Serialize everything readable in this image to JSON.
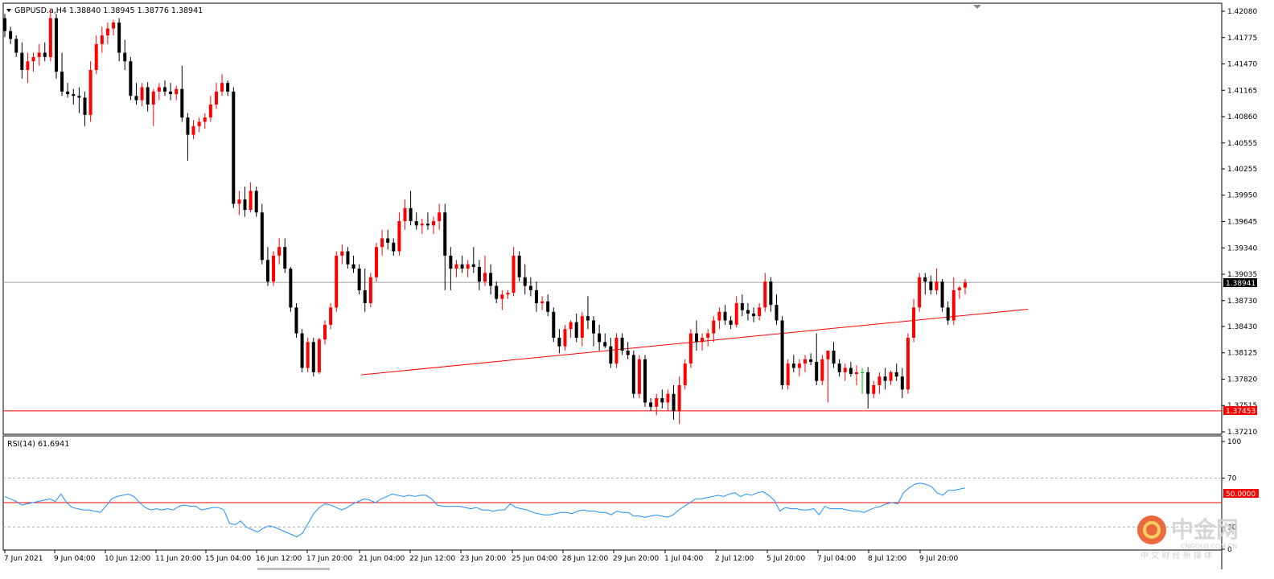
{
  "main_chart": {
    "symbol_header": "GBPUSD.a,H4  1.38840 1.38945 1.38776 1.38941",
    "type": "candlestick",
    "current_price_label": "1.38941",
    "support_label": "1.37453",
    "y_ticks": [
      "1.42080",
      "1.41775",
      "1.41470",
      "1.41165",
      "1.40860",
      "1.40555",
      "1.40255",
      "1.39950",
      "1.39645",
      "1.39340",
      "1.39035",
      "1.38730",
      "1.38430",
      "1.38125",
      "1.37820",
      "1.37515",
      "1.37210"
    ],
    "colors": {
      "bull": "#ff0000",
      "bear": "#000000",
      "doji": "#00c000",
      "trendline": "#ff0000",
      "support": "#ff0000",
      "current": "#a0a0a0"
    }
  },
  "rsi_panel": {
    "header": "RSI(14) 61.6941",
    "level_label": "50.0000",
    "y_ticks": [
      "100",
      "70",
      "30",
      "0"
    ],
    "line_color": "#1e90ff"
  },
  "x_axis": {
    "labels": [
      "7 Jun 2021",
      "9 Jun 04:00",
      "10 Jun 12:00",
      "11 Jun 20:00",
      "15 Jun 04:00",
      "16 Jun 12:00",
      "17 Jun 20:00",
      "21 Jun 04:00",
      "22 Jun 12:00",
      "23 Jun 20:00",
      "25 Jun 04:00",
      "28 Jun 12:00",
      "29 Jun 20:00",
      "1 Jul 04:00",
      "2 Jul 12:00",
      "5 Jul 20:00",
      "7 Jul 04:00",
      "8 Jul 12:00",
      "9 Jul 20:00"
    ]
  },
  "watermark": {
    "logo_text": "中金网",
    "domain": "CNGOLD.COM.CN",
    "tagline": "中 文 财 经 新 媒 体"
  },
  "chart_data": [
    {
      "type": "candlestick",
      "title": "GBPUSD.a,H4",
      "ylim": [
        1.3706,
        1.4216
      ],
      "current_price": 1.38941,
      "horizontal_lines": [
        1.38941,
        1.37453
      ],
      "trendline": {
        "from": [
          "21 Jun 04:00",
          1.3787
        ],
        "to": [
          "projected",
          1.3863
        ]
      },
      "candles_ohlc": [
        [
          1.42,
          1.4205,
          1.4178,
          1.4185
        ],
        [
          1.4185,
          1.419,
          1.417,
          1.4176
        ],
        [
          1.4176,
          1.418,
          1.4155,
          1.416
        ],
        [
          1.416,
          1.4172,
          1.413,
          1.414
        ],
        [
          1.414,
          1.416,
          1.4125,
          1.415
        ],
        [
          1.415,
          1.416,
          1.4138,
          1.4155
        ],
        [
          1.4155,
          1.417,
          1.4145,
          1.416
        ],
        [
          1.416,
          1.4172,
          1.415,
          1.4155
        ],
        [
          1.4155,
          1.421,
          1.415,
          1.42
        ],
        [
          1.42,
          1.4205,
          1.413,
          1.4138
        ],
        [
          1.4138,
          1.416,
          1.411,
          1.4115
        ],
        [
          1.4115,
          1.4125,
          1.4108,
          1.4112
        ],
        [
          1.4112,
          1.4118,
          1.41,
          1.411
        ],
        [
          1.411,
          1.412,
          1.409,
          1.4108
        ],
        [
          1.4108,
          1.4115,
          1.4075,
          1.4088
        ],
        [
          1.4088,
          1.415,
          1.408,
          1.414
        ],
        [
          1.414,
          1.418,
          1.4135,
          1.417
        ],
        [
          1.417,
          1.419,
          1.416,
          1.418
        ],
        [
          1.418,
          1.4195,
          1.417,
          1.4188
        ],
        [
          1.4188,
          1.4198,
          1.418,
          1.4195
        ],
        [
          1.4195,
          1.42,
          1.415,
          1.416
        ],
        [
          1.416,
          1.4175,
          1.414,
          1.415
        ],
        [
          1.415,
          1.4155,
          1.4105,
          1.411
        ],
        [
          1.411,
          1.4125,
          1.41,
          1.4105
        ],
        [
          1.4105,
          1.4125,
          1.4098,
          1.412
        ],
        [
          1.412,
          1.4126,
          1.4092,
          1.41
        ],
        [
          1.41,
          1.4118,
          1.4075,
          1.4115
        ],
        [
          1.4115,
          1.4125,
          1.4105,
          1.412
        ],
        [
          1.412,
          1.4128,
          1.411,
          1.4115
        ],
        [
          1.4115,
          1.4125,
          1.4105,
          1.4112
        ],
        [
          1.4112,
          1.4122,
          1.4105,
          1.4118
        ],
        [
          1.4118,
          1.4145,
          1.408,
          1.4085
        ],
        [
          1.4085,
          1.409,
          1.4035,
          1.4065
        ],
        [
          1.4065,
          1.4082,
          1.406,
          1.4075
        ],
        [
          1.4075,
          1.4085,
          1.4068,
          1.408
        ],
        [
          1.408,
          1.409,
          1.4072,
          1.4085
        ],
        [
          1.4085,
          1.411,
          1.408,
          1.41
        ],
        [
          1.41,
          1.4125,
          1.4095,
          1.4115
        ],
        [
          1.4115,
          1.4135,
          1.411,
          1.4125
        ],
        [
          1.4125,
          1.4128,
          1.411,
          1.4115
        ],
        [
          1.4115,
          1.412,
          1.398,
          1.3985
        ],
        [
          1.3985,
          1.4,
          1.3972,
          1.399
        ],
        [
          1.399,
          1.4005,
          1.397,
          1.3978
        ],
        [
          1.3978,
          1.401,
          1.3975,
          1.4
        ],
        [
          1.4,
          1.4005,
          1.397,
          1.3975
        ],
        [
          1.3975,
          1.3985,
          1.3915,
          1.392
        ],
        [
          1.392,
          1.3935,
          1.389,
          1.3895
        ],
        [
          1.3895,
          1.393,
          1.389,
          1.3925
        ],
        [
          1.3925,
          1.3945,
          1.3915,
          1.3935
        ],
        [
          1.3935,
          1.3945,
          1.3905,
          1.391
        ],
        [
          1.391,
          1.3912,
          1.386,
          1.3865
        ],
        [
          1.3865,
          1.387,
          1.383,
          1.3835
        ],
        [
          1.3835,
          1.384,
          1.379,
          1.3795
        ],
        [
          1.3795,
          1.383,
          1.379,
          1.3825
        ],
        [
          1.3825,
          1.383,
          1.3785,
          1.379
        ],
        [
          1.379,
          1.383,
          1.3788,
          1.3828
        ],
        [
          1.3828,
          1.385,
          1.3822,
          1.3845
        ],
        [
          1.3845,
          1.387,
          1.384,
          1.3865
        ],
        [
          1.3865,
          1.393,
          1.386,
          1.3925
        ],
        [
          1.3925,
          1.3938,
          1.3915,
          1.393
        ],
        [
          1.393,
          1.3935,
          1.391,
          1.3915
        ],
        [
          1.3915,
          1.3925,
          1.3905,
          1.391
        ],
        [
          1.391,
          1.3915,
          1.388,
          1.3885
        ],
        [
          1.3885,
          1.391,
          1.386,
          1.387
        ],
        [
          1.387,
          1.3905,
          1.3865,
          1.39
        ],
        [
          1.39,
          1.394,
          1.3895,
          1.3935
        ],
        [
          1.3935,
          1.3955,
          1.3925,
          1.3945
        ],
        [
          1.3945,
          1.3955,
          1.3932,
          1.394
        ],
        [
          1.394,
          1.3945,
          1.3925,
          1.393
        ],
        [
          1.393,
          1.3975,
          1.3925,
          1.3965
        ],
        [
          1.3965,
          1.399,
          1.3955,
          1.398
        ],
        [
          1.398,
          1.4,
          1.396,
          1.3965
        ],
        [
          1.3965,
          1.3975,
          1.3955,
          1.396
        ],
        [
          1.396,
          1.3968,
          1.395,
          1.3962
        ],
        [
          1.3962,
          1.3975,
          1.3955,
          1.396
        ],
        [
          1.396,
          1.397,
          1.395,
          1.3965
        ],
        [
          1.3965,
          1.3985,
          1.3955,
          1.3975
        ],
        [
          1.3975,
          1.3985,
          1.3885,
          1.3925
        ],
        [
          1.3925,
          1.3935,
          1.3885,
          1.391
        ],
        [
          1.391,
          1.392,
          1.39,
          1.3915
        ],
        [
          1.3915,
          1.3925,
          1.3905,
          1.391
        ],
        [
          1.391,
          1.392,
          1.39,
          1.3915
        ],
        [
          1.3915,
          1.3935,
          1.3905,
          1.3912
        ],
        [
          1.3912,
          1.392,
          1.3885,
          1.3895
        ],
        [
          1.3895,
          1.3925,
          1.389,
          1.3905
        ],
        [
          1.3905,
          1.3915,
          1.388,
          1.389
        ],
        [
          1.389,
          1.3895,
          1.387,
          1.3875
        ],
        [
          1.3875,
          1.3885,
          1.3862,
          1.388
        ],
        [
          1.388,
          1.3885,
          1.3875,
          1.3882
        ],
        [
          1.3882,
          1.3935,
          1.3878,
          1.3925
        ],
        [
          1.3925,
          1.393,
          1.3895,
          1.39
        ],
        [
          1.39,
          1.3915,
          1.388,
          1.389
        ],
        [
          1.389,
          1.39,
          1.3878,
          1.3885
        ],
        [
          1.3885,
          1.3895,
          1.386,
          1.387
        ],
        [
          1.387,
          1.3878,
          1.3862,
          1.3872
        ],
        [
          1.3872,
          1.388,
          1.3855,
          1.386
        ],
        [
          1.386,
          1.3865,
          1.3825,
          1.383
        ],
        [
          1.383,
          1.384,
          1.3812,
          1.382
        ],
        [
          1.382,
          1.3845,
          1.3815,
          1.384
        ],
        [
          1.384,
          1.385,
          1.383,
          1.3848
        ],
        [
          1.3848,
          1.3858,
          1.3825,
          1.383
        ],
        [
          1.383,
          1.386,
          1.382,
          1.3855
        ],
        [
          1.3855,
          1.3878,
          1.384,
          1.385
        ],
        [
          1.385,
          1.3855,
          1.382,
          1.3835
        ],
        [
          1.3835,
          1.3845,
          1.3815,
          1.3825
        ],
        [
          1.3825,
          1.3835,
          1.3818,
          1.382
        ],
        [
          1.382,
          1.383,
          1.3795,
          1.38
        ],
        [
          1.38,
          1.3835,
          1.3795,
          1.383
        ],
        [
          1.383,
          1.3835,
          1.381,
          1.3815
        ],
        [
          1.3815,
          1.3825,
          1.3805,
          1.381
        ],
        [
          1.381,
          1.3815,
          1.376,
          1.3765
        ],
        [
          1.3765,
          1.381,
          1.376,
          1.3805
        ],
        [
          1.3805,
          1.381,
          1.375,
          1.3755
        ],
        [
          1.3755,
          1.376,
          1.3745,
          1.375
        ],
        [
          1.375,
          1.3765,
          1.374,
          1.376
        ],
        [
          1.376,
          1.377,
          1.3748,
          1.3755
        ],
        [
          1.3755,
          1.377,
          1.3745,
          1.3765
        ],
        [
          1.3765,
          1.3775,
          1.3735,
          1.3745
        ],
        [
          1.3745,
          1.3785,
          1.373,
          1.3775
        ],
        [
          1.3775,
          1.3805,
          1.377,
          1.38
        ],
        [
          1.38,
          1.384,
          1.3795,
          1.3835
        ],
        [
          1.3835,
          1.385,
          1.3815,
          1.3825
        ],
        [
          1.3825,
          1.3835,
          1.3815,
          1.383
        ],
        [
          1.383,
          1.384,
          1.382,
          1.3835
        ],
        [
          1.3835,
          1.3855,
          1.3825,
          1.385
        ],
        [
          1.385,
          1.3865,
          1.384,
          1.386
        ],
        [
          1.386,
          1.3868,
          1.3845,
          1.385
        ],
        [
          1.385,
          1.3855,
          1.384,
          1.3845
        ],
        [
          1.3845,
          1.3878,
          1.3842,
          1.387
        ],
        [
          1.387,
          1.388,
          1.3855,
          1.3862
        ],
        [
          1.3862,
          1.387,
          1.385,
          1.3858
        ],
        [
          1.3858,
          1.3865,
          1.3848,
          1.3855
        ],
        [
          1.3855,
          1.387,
          1.385,
          1.3865
        ],
        [
          1.3865,
          1.3905,
          1.386,
          1.3895
        ],
        [
          1.3895,
          1.39,
          1.386,
          1.3868
        ],
        [
          1.3868,
          1.388,
          1.3845,
          1.385
        ],
        [
          1.385,
          1.3855,
          1.377,
          1.3775
        ],
        [
          1.3775,
          1.3805,
          1.377,
          1.38
        ],
        [
          1.38,
          1.381,
          1.379,
          1.3795
        ],
        [
          1.3795,
          1.3805,
          1.3785,
          1.38
        ],
        [
          1.38,
          1.381,
          1.379,
          1.3805
        ],
        [
          1.3805,
          1.3812,
          1.3798,
          1.3802
        ],
        [
          1.3802,
          1.3835,
          1.3775,
          1.378
        ],
        [
          1.378,
          1.381,
          1.3775,
          1.3805
        ],
        [
          1.3805,
          1.3812,
          1.3755,
          1.3815
        ],
        [
          1.3815,
          1.3825,
          1.3795,
          1.38
        ],
        [
          1.38,
          1.3805,
          1.3785,
          1.379
        ],
        [
          1.379,
          1.38,
          1.378,
          1.3795
        ],
        [
          1.3795,
          1.3802,
          1.3785,
          1.3788
        ],
        [
          1.3788,
          1.3798,
          1.3775,
          1.379
        ],
        [
          1.379,
          1.3795,
          1.3765,
          1.379
        ],
        [
          1.379,
          1.3796,
          1.3748,
          1.3765
        ],
        [
          1.3765,
          1.378,
          1.376,
          1.3775
        ],
        [
          1.3775,
          1.379,
          1.3765,
          1.3785
        ],
        [
          1.3785,
          1.3795,
          1.377,
          1.378
        ],
        [
          1.378,
          1.3792,
          1.3775,
          1.379
        ],
        [
          1.379,
          1.38,
          1.378,
          1.3785
        ],
        [
          1.3785,
          1.3795,
          1.376,
          1.377
        ],
        [
          1.377,
          1.3835,
          1.3765,
          1.383
        ],
        [
          1.383,
          1.3875,
          1.3825,
          1.3865
        ],
        [
          1.3865,
          1.3905,
          1.386,
          1.39
        ],
        [
          1.39,
          1.3905,
          1.388,
          1.3895
        ],
        [
          1.3895,
          1.3902,
          1.388,
          1.3885
        ],
        [
          1.3885,
          1.391,
          1.388,
          1.3895
        ],
        [
          1.3895,
          1.3898,
          1.386,
          1.3865
        ],
        [
          1.3865,
          1.3872,
          1.3845,
          1.385
        ],
        [
          1.385,
          1.39,
          1.3845,
          1.3885
        ],
        [
          1.3885,
          1.389,
          1.3875,
          1.3888
        ],
        [
          1.3888,
          1.3898,
          1.388,
          1.38941
        ]
      ]
    },
    {
      "type": "line",
      "title": "RSI(14) 61.6941",
      "ylim": [
        0,
        100
      ],
      "levels": [
        70,
        50,
        30
      ],
      "last_value": 61.6941,
      "values": [
        55,
        53,
        51,
        48,
        49,
        50,
        51,
        52,
        53,
        51,
        57,
        50,
        46,
        45,
        44,
        44,
        43,
        42,
        47,
        53,
        55,
        56,
        57,
        55,
        50,
        46,
        44,
        45,
        44,
        45,
        44,
        47,
        48,
        47,
        47,
        44,
        45,
        46,
        46,
        44,
        33,
        32,
        35,
        30,
        28,
        26,
        29,
        31,
        30,
        28,
        26,
        24,
        22,
        25,
        33,
        41,
        46,
        49,
        48,
        46,
        44,
        46,
        49,
        51,
        53,
        52,
        50,
        53,
        55,
        57,
        56,
        55,
        56,
        55,
        56,
        56,
        53,
        48,
        47,
        47,
        47,
        47,
        46,
        45,
        46,
        44,
        44,
        43,
        44,
        44,
        49,
        46,
        45,
        44,
        42,
        41,
        40,
        40,
        41,
        42,
        42,
        41,
        43,
        44,
        43,
        43,
        42,
        42,
        40,
        43,
        42,
        42,
        39,
        39,
        38,
        39,
        40,
        39,
        38,
        40,
        44,
        47,
        50,
        53,
        53,
        54,
        55,
        56,
        55,
        57,
        58,
        55,
        57,
        56,
        58,
        59,
        56,
        52,
        43,
        46,
        45,
        45,
        44,
        44,
        45,
        40,
        47,
        45,
        45,
        45,
        44,
        43,
        43,
        42,
        44,
        46,
        47,
        49,
        50,
        49,
        58,
        62,
        65,
        66,
        65,
        63,
        58,
        56,
        60,
        60,
        61,
        62
      ]
    }
  ]
}
